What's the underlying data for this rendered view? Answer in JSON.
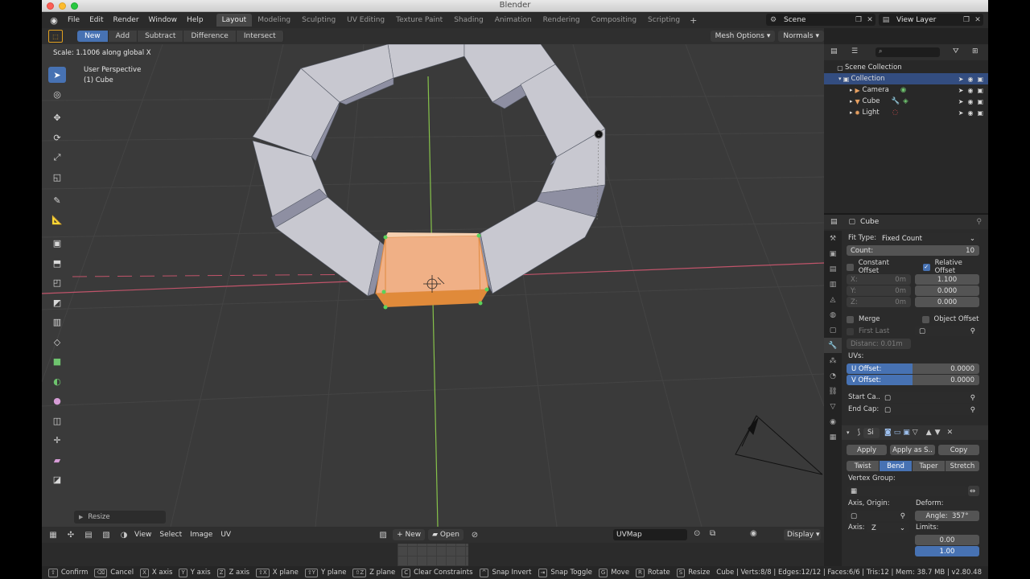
{
  "window": {
    "title": "Blender"
  },
  "topbar": {
    "menus": [
      "File",
      "Edit",
      "Render",
      "Window",
      "Help"
    ],
    "workspaces": [
      "Layout",
      "Modeling",
      "Sculpting",
      "UV Editing",
      "Texture Paint",
      "Shading",
      "Animation",
      "Rendering",
      "Compositing",
      "Scripting"
    ],
    "active_workspace": "Layout",
    "add_workspace": "+",
    "scene": "Scene",
    "view_layer": "View Layer"
  },
  "header": {
    "bool_ops": [
      "New",
      "Add",
      "Subtract",
      "Difference",
      "Intersect"
    ],
    "active_op": "New",
    "mesh_options": "Mesh Options",
    "normals": "Normals"
  },
  "viewport": {
    "operator_info": "Scale: 1.1006 along global X",
    "perspective": "User Perspective",
    "object_label": "(1) Cube",
    "redo_panel": "Resize",
    "colors": {
      "background": "#3a3a3a",
      "grid": "#444444",
      "x_axis": "#c0546a",
      "y_axis": "#86c24a",
      "selection": "#f0b086",
      "block": "#c8c8d0"
    }
  },
  "uv_header": {
    "menus": [
      "View",
      "Select",
      "Image",
      "UV"
    ],
    "new_label": "New",
    "open_label": "Open",
    "uv_map": "UVMap",
    "display": "Display"
  },
  "outliner": {
    "root": "Scene Collection",
    "collection": "Collection",
    "items": [
      {
        "name": "Camera",
        "icon": "camera-icon"
      },
      {
        "name": "Cube",
        "icon": "mesh-icon"
      },
      {
        "name": "Light",
        "icon": "light-icon"
      }
    ]
  },
  "properties": {
    "object_name": "Cube",
    "fit_type_label": "Fit Type:",
    "fit_type": "Fixed Count",
    "count_label": "Count:",
    "count": "10",
    "constant_offset": "Constant Offset",
    "relative_offset": "Relative Offset",
    "axis_x": "X:",
    "axis_y": "Y:",
    "axis_z": "Z:",
    "const_x": "0m",
    "const_y": "0m",
    "const_z": "0m",
    "rel_x": "1.100",
    "rel_y": "0.000",
    "rel_z": "0.000",
    "merge": "Merge",
    "object_offset": "Object Offset",
    "first_last": "First Last",
    "distance": "Distanc: 0.01m",
    "uvs_label": "UVs:",
    "u_offset_label": "U Offset:",
    "u_offset": "0.0000",
    "v_offset_label": "V Offset:",
    "v_offset": "0.0000",
    "start_cap": "Start Ca..",
    "end_cap": "End Cap:",
    "modifier2_name": "Si",
    "apply": "Apply",
    "apply_as": "Apply as S..",
    "copy": "Copy",
    "deform_modes": [
      "Twist",
      "Bend",
      "Taper",
      "Stretch"
    ],
    "active_deform": "Bend",
    "vertex_group": "Vertex Group:",
    "axis_origin": "Axis, Origin:",
    "deform": "Deform:",
    "angle": "Angle:",
    "angle_value": "357°",
    "axis_label": "Axis:",
    "axis_value": "Z",
    "limits": "Limits:",
    "limit_low": "0.00",
    "limit_high": "1.00"
  },
  "statusbar": {
    "items": [
      {
        "key": "⇧",
        "label": "Confirm"
      },
      {
        "key": "⌫",
        "label": "Cancel"
      },
      {
        "key": "X",
        "label": "X axis"
      },
      {
        "key": "Y",
        "label": "Y axis"
      },
      {
        "key": "Z",
        "label": "Z axis"
      },
      {
        "key": "⇧X",
        "label": "X plane"
      },
      {
        "key": "⇧Y",
        "label": "Y plane"
      },
      {
        "key": "⇧Z",
        "label": "Z plane"
      },
      {
        "key": "C",
        "label": "Clear Constraints"
      },
      {
        "key": "^",
        "label": "Snap Invert"
      },
      {
        "key": "⇥",
        "label": "Snap Toggle"
      },
      {
        "key": "G",
        "label": "Move"
      },
      {
        "key": "R",
        "label": "Rotate"
      },
      {
        "key": "S",
        "label": "Resize"
      }
    ],
    "stats": "Cube | Verts:8/8 | Edges:12/12 | Faces:6/6 | Tris:12 | Mem: 38.7 MB | v2.80.48"
  }
}
